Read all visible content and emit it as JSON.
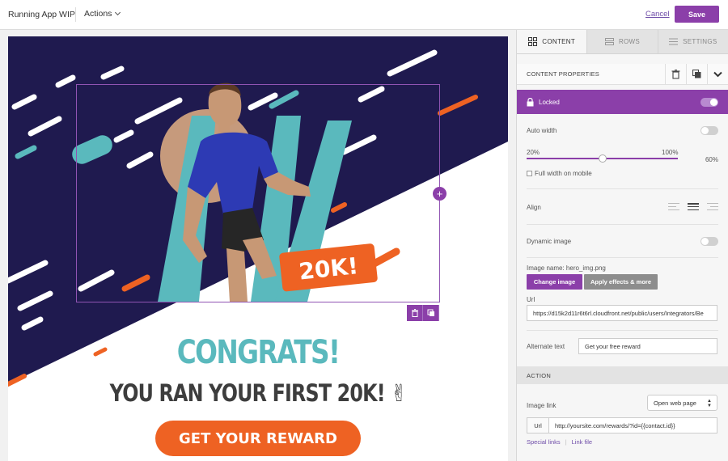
{
  "topbar": {
    "app_title": "Running App WIP",
    "actions_label": "Actions",
    "cancel_label": "Cancel",
    "save_label": "Save"
  },
  "email": {
    "badge_text": "20K!",
    "headline": "CONGRATS!",
    "subline": "YOU RAN YOUR FIRST 20K! ✌",
    "cta_label": "GET YOUR REWARD"
  },
  "panel": {
    "tabs": [
      {
        "label": "CONTENT",
        "icon": "grid-icon",
        "active": true
      },
      {
        "label": "ROWS",
        "icon": "rows-icon",
        "active": false
      },
      {
        "label": "SETTINGS",
        "icon": "settings-icon",
        "active": false
      }
    ],
    "content_properties_title": "CONTENT PROPERTIES",
    "locked_label": "Locked",
    "auto_width_label": "Auto width",
    "slider_min_label": "20%",
    "slider_max_label": "100%",
    "width_value": "60%",
    "width_fraction": 0.5,
    "full_width_label": "Full width on mobile",
    "align_label": "Align",
    "dynamic_image_label": "Dynamic image",
    "image_name_label": "Image name: hero_img.png",
    "change_image_label": "Change image",
    "apply_effects_label": "Apply effects & more",
    "url_label": "Url",
    "url_value": "https://d15k2d11r6t6rl.cloudfront.net/public/users/Integrators/Be",
    "alt_text_label": "Alternate text",
    "alt_text_value": "Get your free reward",
    "action_header": "ACTION",
    "image_link_label": "Image link",
    "image_link_option": "Open web page",
    "link_url_label": "Url",
    "link_url_value": "http://yoursite.com/rewards/?id={{contact.id}}",
    "special_links_label": "Special links",
    "link_file_label": "Link file"
  },
  "colors": {
    "brand_purple": "#8b3fa9",
    "hero_navy": "#1f1a4f",
    "accent_teal": "#5ab9bd",
    "accent_orange": "#ee6223"
  }
}
